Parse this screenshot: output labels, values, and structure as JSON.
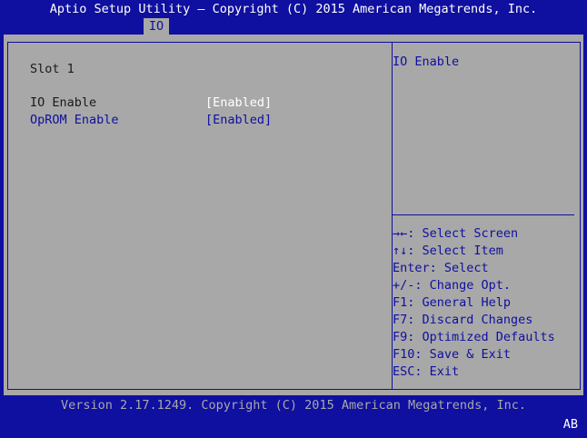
{
  "title": "Aptio Setup Utility – Copyright (C) 2015 American Megatrends, Inc.",
  "tabs": [
    {
      "label": "IO",
      "active": true
    }
  ],
  "section_heading": "Slot 1",
  "settings": [
    {
      "label": "IO Enable",
      "value": "[Enabled]"
    },
    {
      "label": "OpROM Enable",
      "value": "[Enabled]"
    }
  ],
  "help": {
    "title": "IO Enable"
  },
  "keys": [
    "→←: Select Screen",
    "↑↓: Select Item",
    "Enter: Select",
    "+/-: Change Opt.",
    "F1: General Help",
    "F7: Discard Changes",
    "F9: Optimized Defaults",
    "F10: Save & Exit",
    "ESC: Exit"
  ],
  "footer": "Version 2.17.1249. Copyright (C) 2015 American Megatrends, Inc.",
  "corner_label": "AB",
  "colors": {
    "background": "#0f0fa0",
    "panel": "#a8a8a8",
    "text_dark": "#1a1a1a",
    "text_highlight": "#ffffff"
  }
}
